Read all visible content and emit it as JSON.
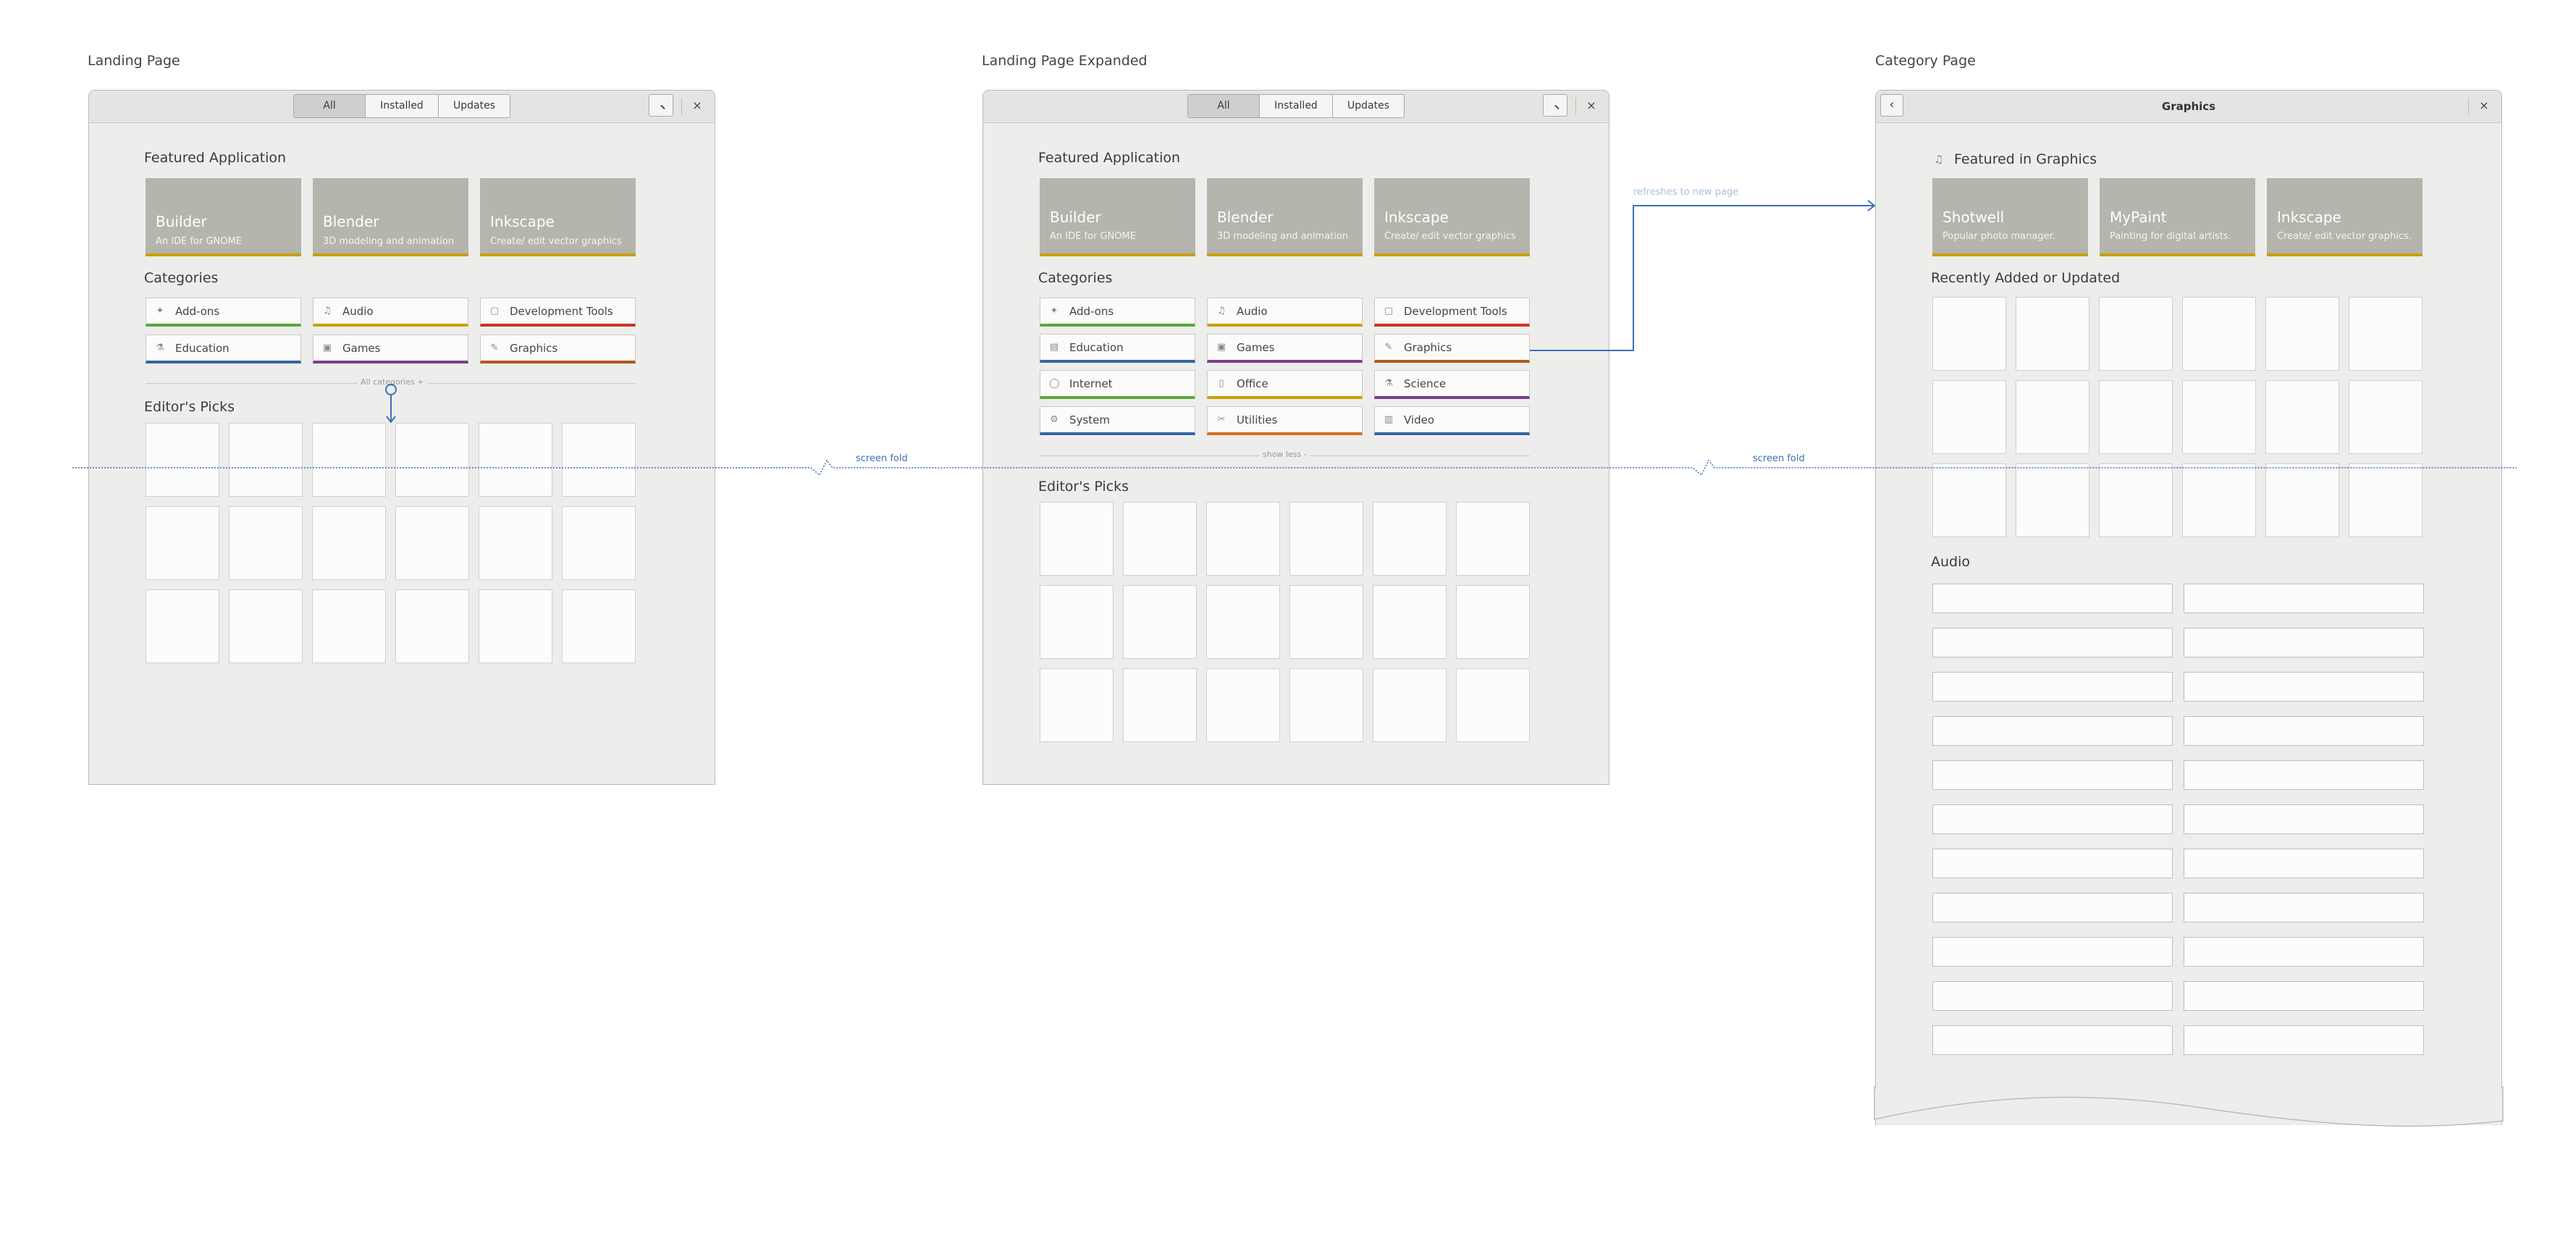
{
  "colors": {
    "background": "#ffffff",
    "window_bg": "#ededeb",
    "tile_bg": "#b5b5ad",
    "tile_underline": "#c9a000",
    "annotation_blue": "#3f6fb7",
    "cat_green": "#5ba83c",
    "cat_yellow": "#c9a000",
    "cat_orange": "#d26d1c",
    "cat_blue": "#3465a4",
    "cat_purple": "#7a3e8e",
    "cat_red": "#c8322b",
    "cat_brown": "#b3571e"
  },
  "panels": {
    "landing": {
      "title": "Landing Page"
    },
    "expanded": {
      "title": "Landing Page Expanded"
    },
    "category": {
      "title": "Category Page"
    }
  },
  "header": {
    "tabs": [
      "All",
      "Installed",
      "Updates"
    ],
    "active_tab": "All",
    "close": "×",
    "back": "‹",
    "category_title": "Graphics"
  },
  "sections": {
    "featured": "Featured Application",
    "categories": "Categories",
    "editors_picks": "Editor's Picks",
    "featured_in": "Featured in Graphics",
    "recent": "Recently Added or Updated",
    "audio": "Audio"
  },
  "featured_apps": [
    {
      "name": "Builder",
      "desc": "An IDE for GNOME"
    },
    {
      "name": "Blender",
      "desc": "3D modeling and animation"
    },
    {
      "name": "Inkscape",
      "desc": "Create/ edit vector graphics"
    }
  ],
  "graphics_featured": [
    {
      "name": "Shotwell",
      "desc": "Popular photo manager."
    },
    {
      "name": "MyPaint",
      "desc": "Painting for digital artists."
    },
    {
      "name": "Inkscape",
      "desc": "Create/ edit vector graphics."
    }
  ],
  "categories": [
    {
      "label": "Add-ons",
      "icon": "puzzle-icon",
      "color": "#5ba83c"
    },
    {
      "label": "Audio",
      "icon": "music-note-icon",
      "color": "#c9a000"
    },
    {
      "label": "Development Tools",
      "icon": "code-icon",
      "color": "#c8322b"
    },
    {
      "label": "Education",
      "icon": "flask-icon",
      "color": "#3465a4"
    },
    {
      "label": "Games",
      "icon": "gamepad-icon",
      "color": "#7a3e8e"
    },
    {
      "label": "Graphics",
      "icon": "paintbrush-icon",
      "color": "#b3571e"
    },
    {
      "label": "Internet",
      "icon": "globe-icon",
      "color": "#5ba83c"
    },
    {
      "label": "Office",
      "icon": "document-icon",
      "color": "#c9a000"
    },
    {
      "label": "Science",
      "icon": "flask-icon",
      "color": "#7a3e8e"
    },
    {
      "label": "System",
      "icon": "gear-icon",
      "color": "#3465a4"
    },
    {
      "label": "Utilities",
      "icon": "tools-icon",
      "color": "#d26d1c"
    },
    {
      "label": "Video",
      "icon": "video-icon",
      "color": "#3465a4"
    }
  ],
  "links": {
    "all_categories": "All categories +",
    "show_less": "show less -"
  },
  "annotations": {
    "screen_fold": "screen fold",
    "refreshes": "refreshes to new page"
  }
}
